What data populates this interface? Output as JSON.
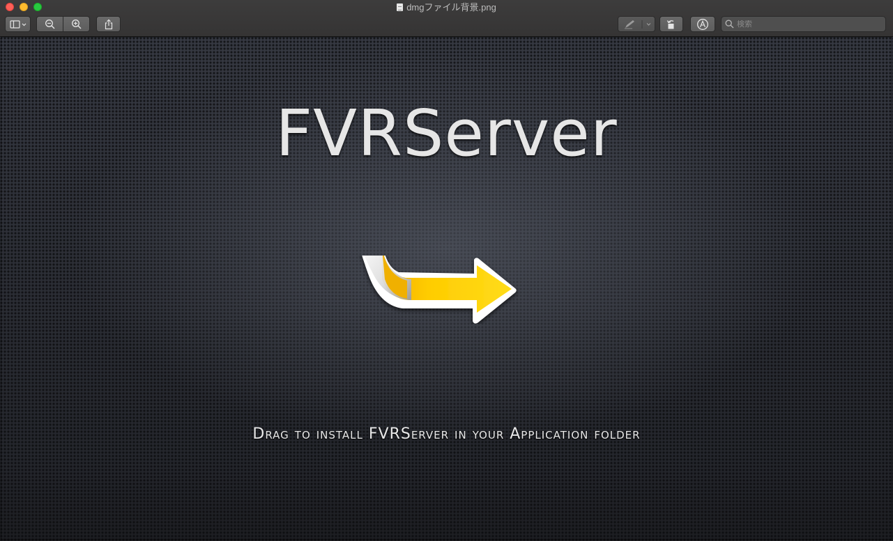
{
  "window": {
    "title": "dmgファイル背景.png",
    "traffic_lights": [
      "close",
      "minimize",
      "zoom"
    ]
  },
  "toolbar": {
    "left_buttons": [
      {
        "name": "sidebar-toggle",
        "icon": "sidebar-icon"
      },
      {
        "name": "zoom-out",
        "icon": "zoom-out-icon"
      },
      {
        "name": "zoom-in",
        "icon": "zoom-in-icon"
      },
      {
        "name": "share",
        "icon": "share-icon"
      }
    ],
    "right_buttons": [
      {
        "name": "markup-pen",
        "icon": "pen-icon"
      },
      {
        "name": "rotate",
        "icon": "rotate-icon"
      },
      {
        "name": "markup-toolbar",
        "icon": "markup-icon"
      }
    ],
    "search_placeholder": "検索"
  },
  "image": {
    "app_name": "FVRServer",
    "instruction": "Drag to install FVRServer in your Application folder",
    "arrow_color": "#ffcc00"
  },
  "colors": {
    "close": "#fe5f57",
    "minimize": "#febc2e",
    "zoom": "#28c840"
  }
}
